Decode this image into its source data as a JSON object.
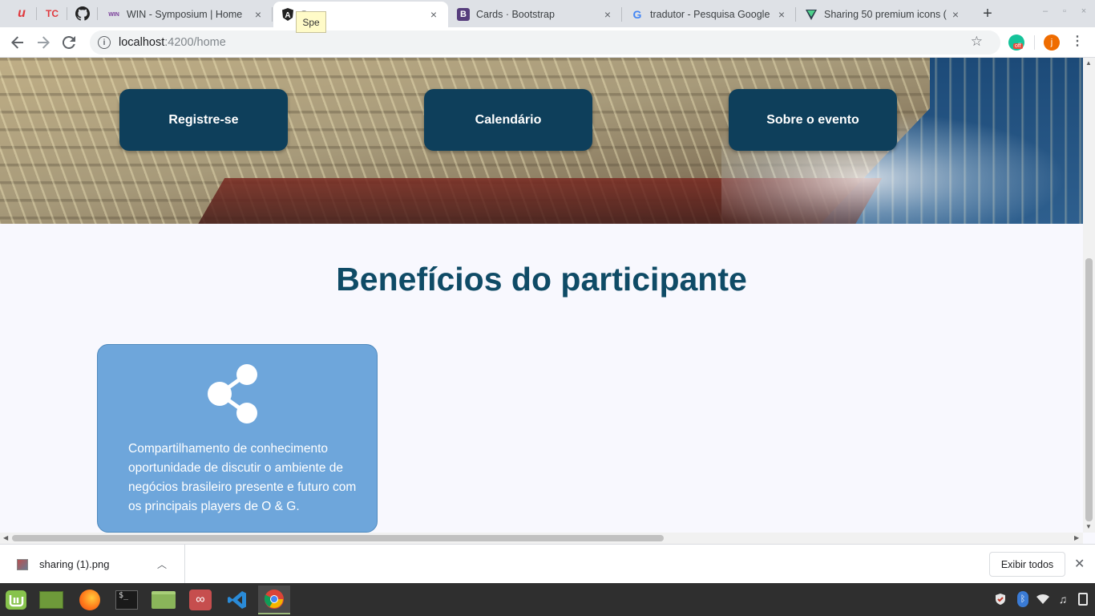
{
  "browser": {
    "tabs": [
      {
        "title": "WIN - Symposium | Home",
        "close": "×"
      },
      {
        "title": "Spe",
        "close": "×"
      },
      {
        "title": "Cards · Bootstrap",
        "close": "×"
      },
      {
        "title": "tradutor - Pesquisa Google",
        "close": "×"
      },
      {
        "title": "Sharing 50 premium icons (",
        "close": "×"
      }
    ],
    "pinned": [
      {
        "label": "u"
      },
      {
        "label": "TC"
      }
    ],
    "new_tab": "+",
    "tooltip": "Spe",
    "url_host": "localhost",
    "url_path": ":4200/home",
    "grammarly_badge": "off",
    "profile_initial": "j",
    "colors": {
      "accent": "#0e3f5b",
      "card": "#6ea6db",
      "title": "#0f4b66"
    }
  },
  "hero": {
    "buttons": [
      {
        "label": "Registre-se"
      },
      {
        "label": "Calendário"
      },
      {
        "label": "Sobre o evento"
      }
    ]
  },
  "benefits": {
    "title": "Benefícios do participante",
    "cards": [
      {
        "icon": "share-icon",
        "text": "Compartilhamento de conhecimento oportunidade de discutir o ambiente de negócios brasileiro presente e futuro com os principais players de O & G."
      }
    ]
  },
  "downloads": {
    "file_name": "sharing (1).png",
    "show_all": "Exibir todos"
  }
}
